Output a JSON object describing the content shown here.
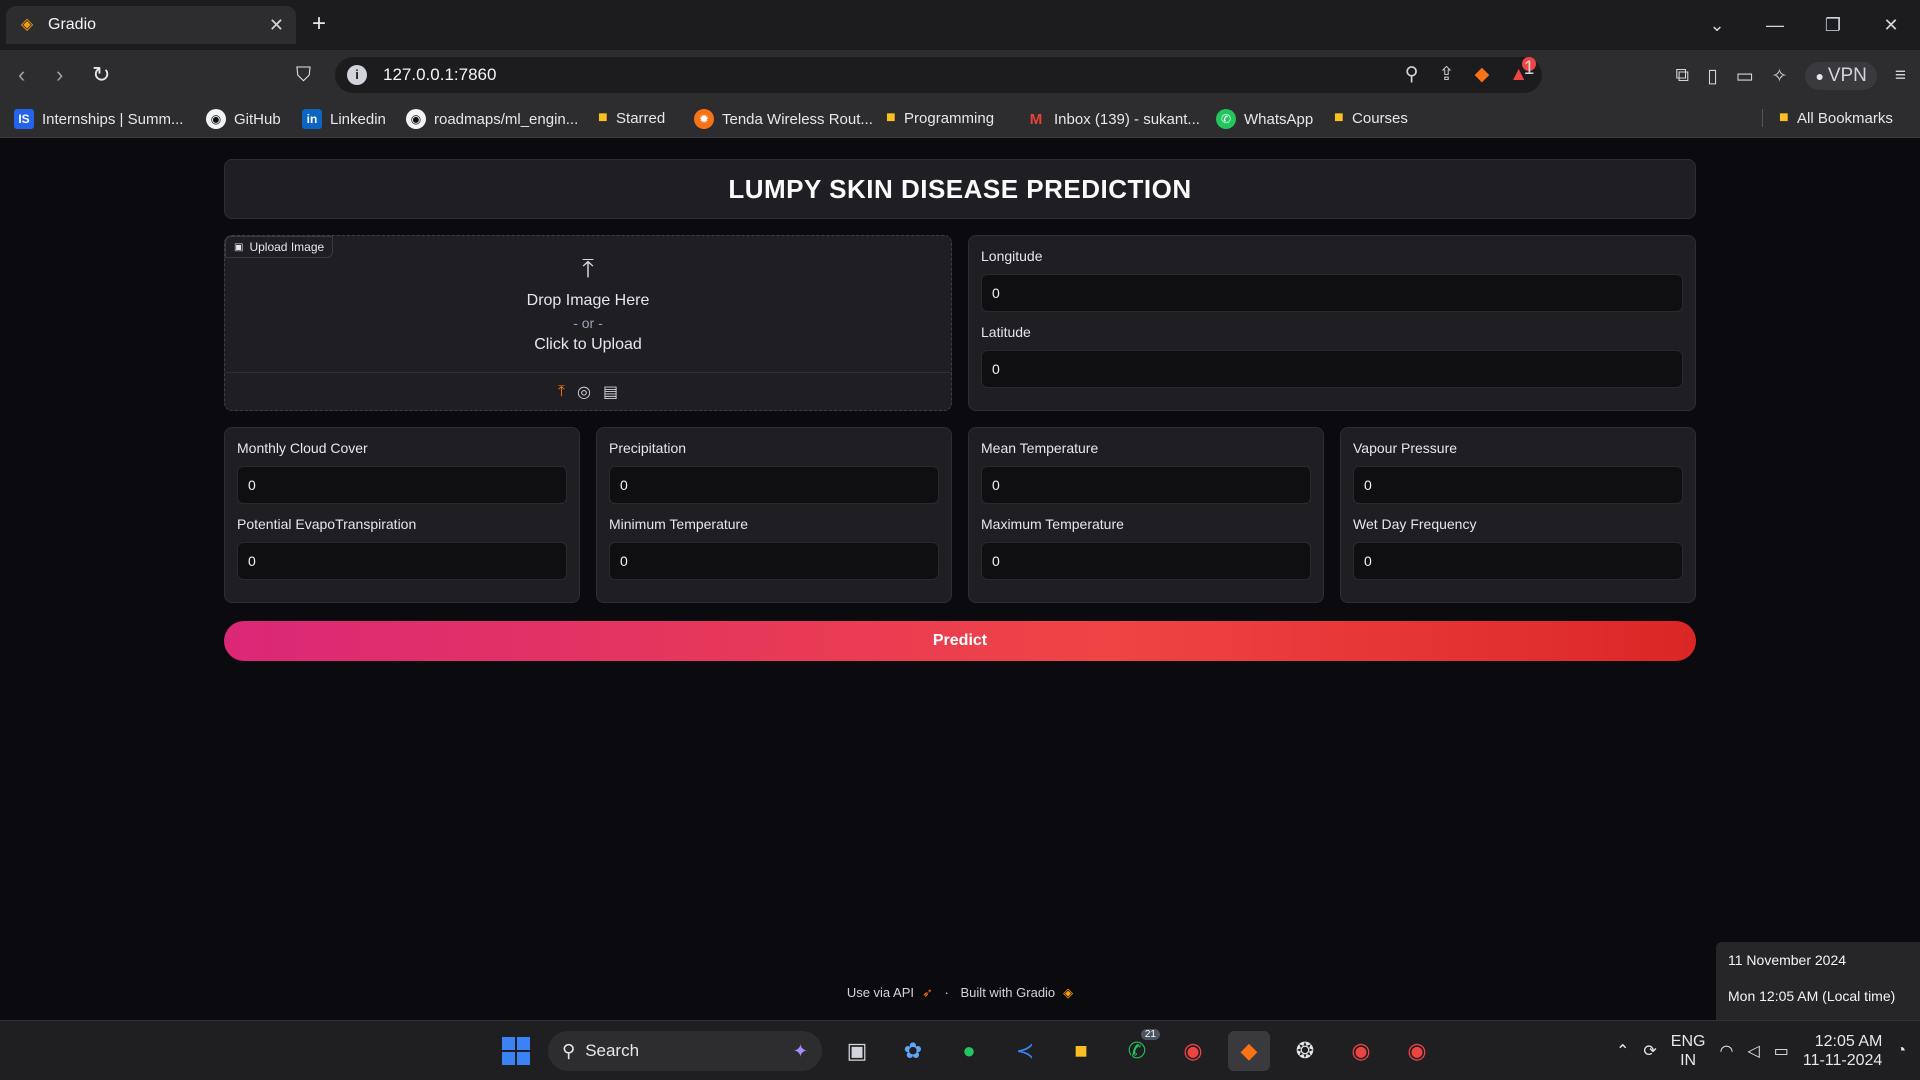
{
  "browser": {
    "tab_title": "Gradio",
    "url": "127.0.0.1:7860",
    "new_tab": "+",
    "vpn_label": "VPN",
    "alert_count": "1"
  },
  "bookmarks": [
    {
      "label": "Internships | Summ...",
      "icon": "IS"
    },
    {
      "label": "GitHub",
      "icon": "github-icon"
    },
    {
      "label": "Linkedin",
      "icon": "in"
    },
    {
      "label": "roadmaps/ml_engin...",
      "icon": "github-icon"
    },
    {
      "label": "Starred",
      "icon": "folder-icon"
    },
    {
      "label": "Tenda Wireless Rout...",
      "icon": "tenda-icon"
    },
    {
      "label": "Programming",
      "icon": "folder-icon"
    },
    {
      "label": "Inbox (139) - sukant...",
      "icon": "gmail-icon"
    },
    {
      "label": "WhatsApp",
      "icon": "whatsapp-icon"
    },
    {
      "label": "Courses",
      "icon": "folder-icon"
    },
    {
      "label": "All Bookmarks",
      "icon": "folder-icon"
    }
  ],
  "app": {
    "title": "LUMPY SKIN DISEASE PREDICTION",
    "upload": {
      "tag": "Upload Image",
      "drop": "Drop Image Here",
      "or": "- or -",
      "click": "Click to Upload"
    },
    "location": {
      "longitude_label": "Longitude",
      "longitude_value": "0",
      "latitude_label": "Latitude",
      "latitude_value": "0"
    },
    "panels": [
      {
        "a_label": "Monthly Cloud Cover",
        "a_value": "0",
        "b_label": "Potential EvapoTranspiration",
        "b_value": "0"
      },
      {
        "a_label": "Precipitation",
        "a_value": "0",
        "b_label": "Minimum Temperature",
        "b_value": "0"
      },
      {
        "a_label": "Mean Temperature",
        "a_value": "0",
        "b_label": "Maximum Temperature",
        "b_value": "0"
      },
      {
        "a_label": "Vapour Pressure",
        "a_value": "0",
        "b_label": "Wet Day Frequency",
        "b_value": "0"
      }
    ],
    "predict_label": "Predict",
    "footer": {
      "api": "Use via API",
      "sep": "·",
      "built": "Built with Gradio"
    }
  },
  "clock_popup": {
    "date": "11 November 2024",
    "local": "Mon 12:05 AM (Local time)"
  },
  "taskbar": {
    "search_label": "Search",
    "whatsapp_badge": "21",
    "lang_line1": "ENG",
    "lang_line2": "IN",
    "time": "12:05 AM",
    "date": "11-11-2024"
  },
  "colors": {
    "accent_gradient_start": "#db2777",
    "accent_gradient_end": "#dc2626",
    "panel_bg": "#1f1f23",
    "page_bg": "#0b0b0f"
  }
}
